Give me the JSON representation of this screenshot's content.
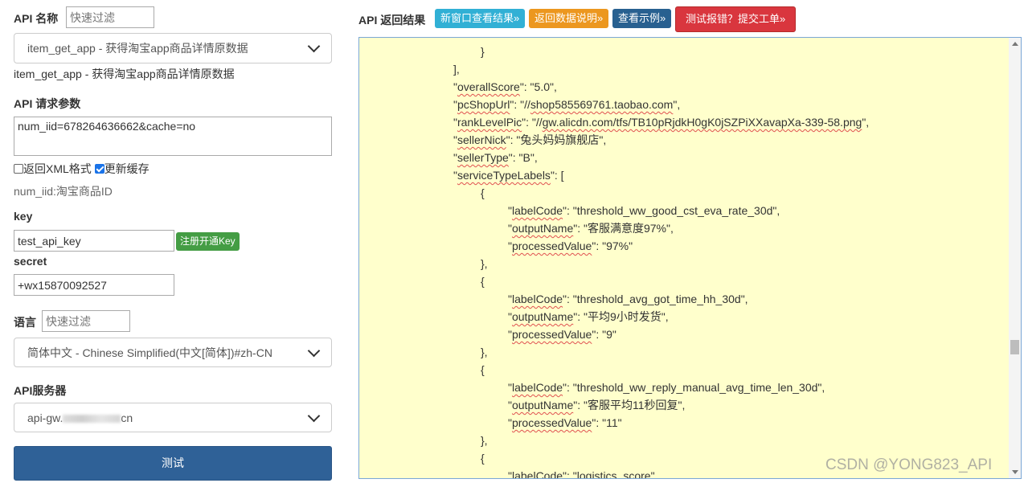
{
  "left": {
    "api_name_label": "API 名称",
    "filter_placeholder": "快速过滤",
    "api_select_value": "item_get_app - 获得淘宝app商品详情原数据",
    "api_desc": "item_get_app - 获得淘宝app商品详情原数据",
    "params_label": "API 请求参数",
    "params_value": "num_iid=678264636662&cache=no",
    "xml_label": "返回XML格式",
    "xml_checked": false,
    "cache_label": "更新缓存",
    "cache_checked": true,
    "param_hint": "num_iid:淘宝商品ID",
    "key_label": "key",
    "key_value": "test_api_key",
    "register_button": "注册开通Key",
    "secret_label": "secret",
    "secret_value": "+wx15870092527",
    "lang_label": "语言",
    "lang_filter_placeholder": "快速过滤",
    "lang_select_value": "简体中文 - Chinese Simplified(中文[简体])#zh-CN",
    "server_label": "API服务器",
    "server_value_prefix": "api-gw.",
    "server_value_suffix": "cn",
    "test_button": "测试"
  },
  "right": {
    "result_label": "API 返回结果",
    "buttons": [
      {
        "label": "新窗口查看结果»",
        "color": "#31b0d5"
      },
      {
        "label": "返回数据说明»",
        "color": "#ec971f"
      },
      {
        "label": "查看示例»",
        "color": "#286090"
      },
      {
        "label": "测试报错？提交工单»",
        "color": "#d9363e"
      }
    ]
  },
  "result_lines": [
    {
      "indent": 4,
      "parts": [
        {
          "t": "}"
        }
      ]
    },
    {
      "indent": 3,
      "parts": [
        {
          "t": "],"
        }
      ]
    },
    {
      "indent": 3,
      "parts": [
        {
          "t": "\""
        },
        {
          "t": "overallScore",
          "k": true
        },
        {
          "t": "\": \"5.0\","
        }
      ]
    },
    {
      "indent": 3,
      "parts": [
        {
          "t": "\""
        },
        {
          "t": "pcShopUrl",
          "k": true
        },
        {
          "t": "\": \"//"
        },
        {
          "t": "shop585569761.taobao.com",
          "k": true
        },
        {
          "t": "\","
        }
      ]
    },
    {
      "indent": 3,
      "parts": [
        {
          "t": "\""
        },
        {
          "t": "rankLevelPic",
          "k": true
        },
        {
          "t": "\": \"//"
        },
        {
          "t": "gw.alicdn.com/tfs/TB10pRjdkH0gK0jSZPiXXavapXa-339-58.png",
          "k": true
        },
        {
          "t": "\","
        }
      ]
    },
    {
      "indent": 3,
      "parts": [
        {
          "t": "\""
        },
        {
          "t": "sellerNick",
          "k": true
        },
        {
          "t": "\": \"兔头妈妈旗舰店\","
        }
      ]
    },
    {
      "indent": 3,
      "parts": [
        {
          "t": "\""
        },
        {
          "t": "sellerType",
          "k": true
        },
        {
          "t": "\": \"B\","
        }
      ]
    },
    {
      "indent": 3,
      "parts": [
        {
          "t": "\""
        },
        {
          "t": "serviceTypeLabels",
          "k": true
        },
        {
          "t": "\": ["
        }
      ]
    },
    {
      "indent": 4,
      "parts": [
        {
          "t": "{"
        }
      ]
    },
    {
      "indent": 5,
      "parts": [
        {
          "t": "\""
        },
        {
          "t": "labelCode",
          "k": true
        },
        {
          "t": "\": \"threshold_ww_good_cst_eva_rate_30d\","
        }
      ]
    },
    {
      "indent": 5,
      "parts": [
        {
          "t": "\""
        },
        {
          "t": "outputName",
          "k": true
        },
        {
          "t": "\": \"客服满意度97%\","
        }
      ]
    },
    {
      "indent": 5,
      "parts": [
        {
          "t": "\""
        },
        {
          "t": "processedValue",
          "k": true
        },
        {
          "t": "\": \"97%\""
        }
      ]
    },
    {
      "indent": 4,
      "parts": [
        {
          "t": "},"
        }
      ]
    },
    {
      "indent": 4,
      "parts": [
        {
          "t": "{"
        }
      ]
    },
    {
      "indent": 5,
      "parts": [
        {
          "t": "\""
        },
        {
          "t": "labelCode",
          "k": true
        },
        {
          "t": "\": \"threshold_avg_got_time_hh_30d\","
        }
      ]
    },
    {
      "indent": 5,
      "parts": [
        {
          "t": "\""
        },
        {
          "t": "outputName",
          "k": true
        },
        {
          "t": "\": \"平均9小时发货\","
        }
      ]
    },
    {
      "indent": 5,
      "parts": [
        {
          "t": "\""
        },
        {
          "t": "processedValue",
          "k": true
        },
        {
          "t": "\": \"9\""
        }
      ]
    },
    {
      "indent": 4,
      "parts": [
        {
          "t": "},"
        }
      ]
    },
    {
      "indent": 4,
      "parts": [
        {
          "t": "{"
        }
      ]
    },
    {
      "indent": 5,
      "parts": [
        {
          "t": "\""
        },
        {
          "t": "labelCode",
          "k": true
        },
        {
          "t": "\": \"threshold_ww_reply_manual_avg_time_len_30d\","
        }
      ]
    },
    {
      "indent": 5,
      "parts": [
        {
          "t": "\""
        },
        {
          "t": "outputName",
          "k": true
        },
        {
          "t": "\": \"客服平均11秒回复\","
        }
      ]
    },
    {
      "indent": 5,
      "parts": [
        {
          "t": "\""
        },
        {
          "t": "processedValue",
          "k": true
        },
        {
          "t": "\": \"11\""
        }
      ]
    },
    {
      "indent": 4,
      "parts": [
        {
          "t": "},"
        }
      ]
    },
    {
      "indent": 4,
      "parts": [
        {
          "t": "{"
        }
      ]
    },
    {
      "indent": 5,
      "parts": [
        {
          "t": "\""
        },
        {
          "t": "labelCode",
          "k": true
        },
        {
          "t": "\": \"logistics_score\","
        }
      ]
    }
  ],
  "watermark": "CSDN @YONG823_API"
}
